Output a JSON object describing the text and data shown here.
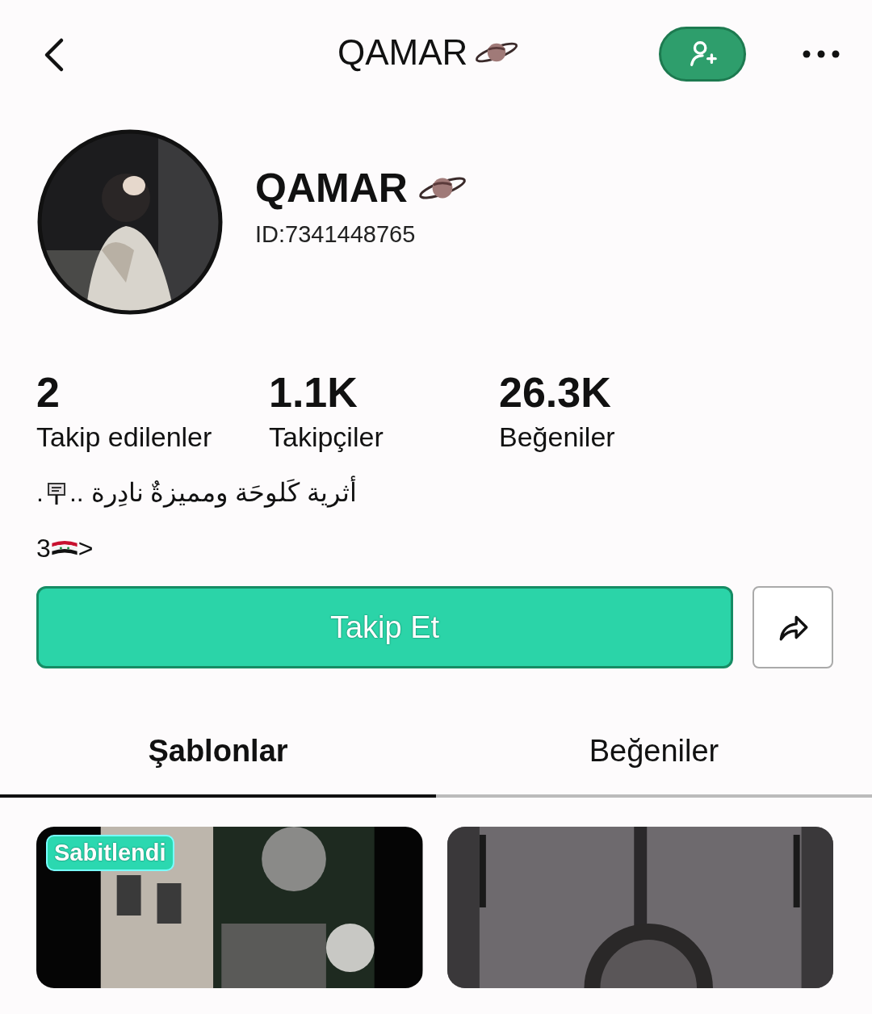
{
  "header": {
    "title": "QAMAR"
  },
  "profile": {
    "name": "QAMAR",
    "id": "ID:7341448765"
  },
  "stats": [
    {
      "value": "2",
      "label": "Takip edilenler"
    },
    {
      "value": "1.1K",
      "label": "Takipçiler"
    },
    {
      "value": "26.3K",
      "label": "Beğeniler"
    }
  ],
  "bio": {
    "text": "أثرية كَلوحَة ومميزةٌ نادِرة ..",
    "end": "."
  },
  "bio_line2": {
    "prefix": "3",
    "suffix": ">"
  },
  "follow_button": {
    "label": "Takip Et"
  },
  "tabs": [
    {
      "label": "Şablonlar",
      "selected": true
    },
    {
      "label": "Beğeniler",
      "selected": false
    }
  ],
  "grid": [
    {
      "kind": "picture",
      "badge": "Sabitlendi"
    },
    {
      "kind": "picture"
    }
  ]
}
